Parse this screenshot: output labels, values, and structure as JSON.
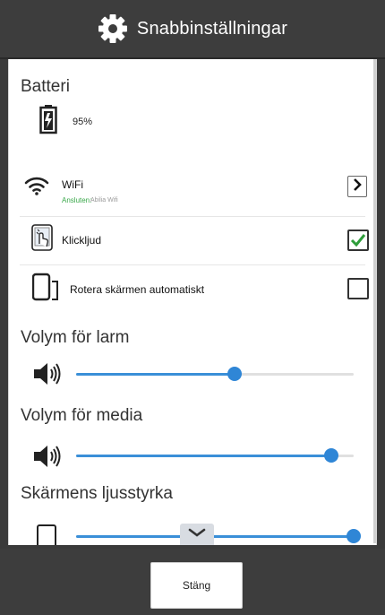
{
  "header": {
    "title": "Snabbinställningar",
    "icon": "gear-icon"
  },
  "battery": {
    "title": "Batteri",
    "level": "95%"
  },
  "wifi": {
    "label": "WiFi",
    "status_label": "Ansluten:",
    "network": "Abilia Wifi"
  },
  "click_sound": {
    "label": "Klickljud",
    "checked": true
  },
  "auto_rotate": {
    "label": "Rotera skärmen automatiskt",
    "checked": false
  },
  "alarm_volume": {
    "title": "Volym för larm",
    "value_fraction": 0.57
  },
  "media_volume": {
    "title": "Volym för media",
    "value_fraction": 0.92
  },
  "brightness": {
    "title": "Skärmens ljusstyrka",
    "value_fraction": 1.0
  },
  "footer": {
    "close_label": "Stäng"
  },
  "colors": {
    "accent": "#3a8fd8",
    "check_green": "#2e9d3a",
    "wifi_status_green": "#3aa84a"
  }
}
